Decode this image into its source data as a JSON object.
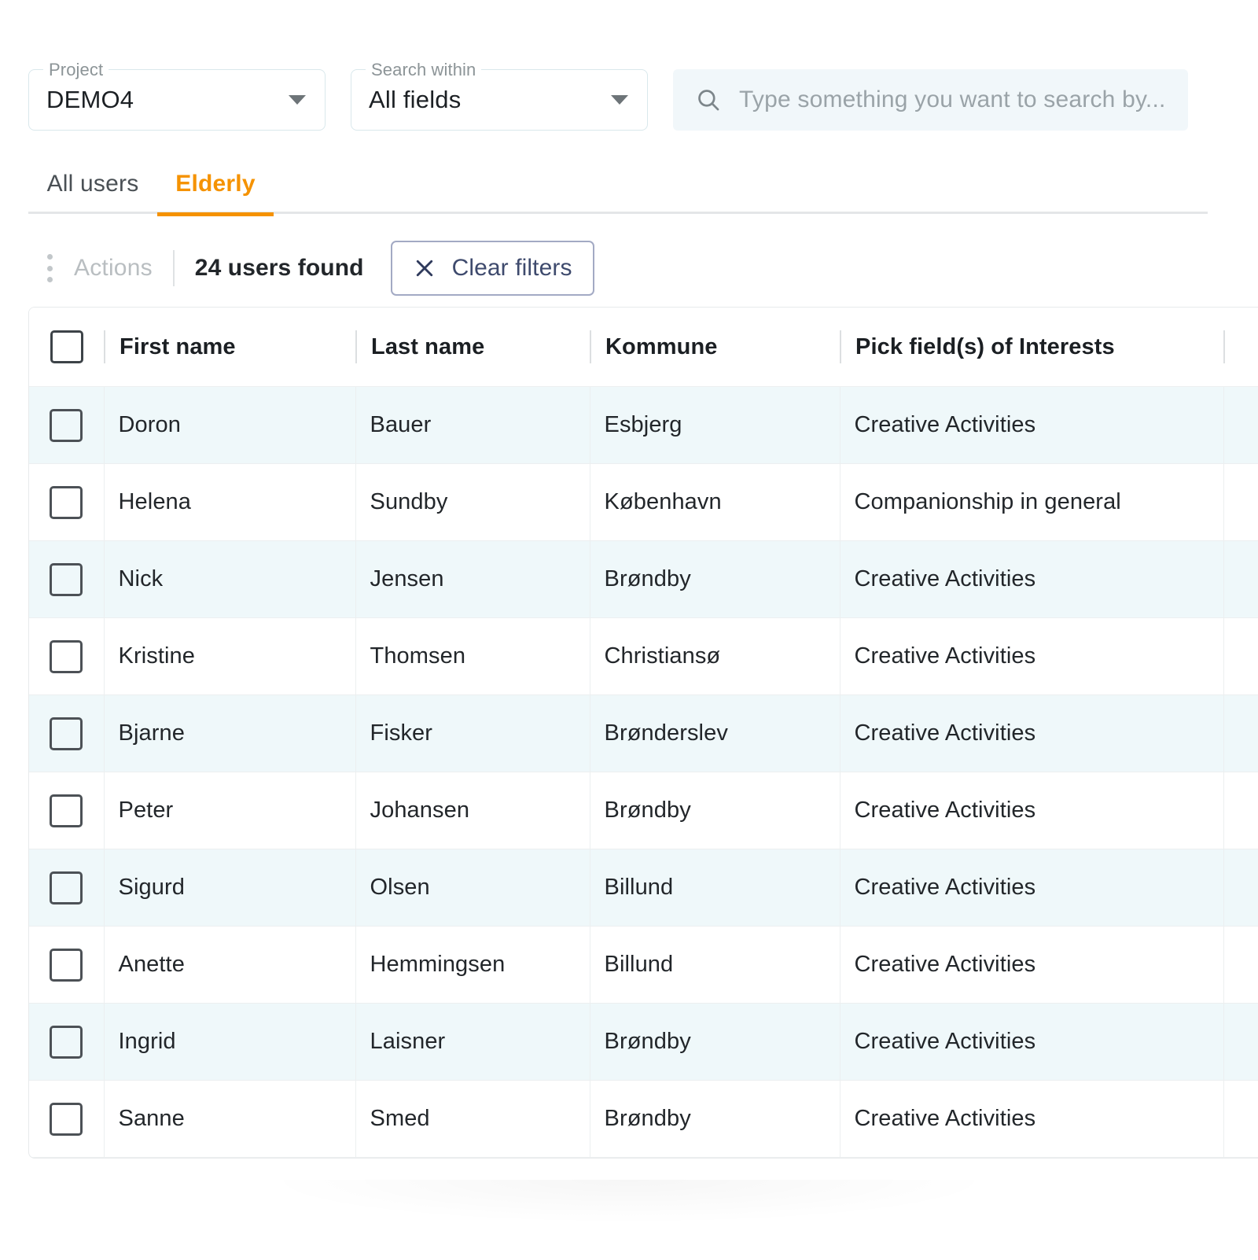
{
  "filters": {
    "project": {
      "label": "Project",
      "value": "DEMO4"
    },
    "search_within": {
      "label": "Search within",
      "value": "All fields"
    },
    "search": {
      "placeholder": "Type something you want to search by...",
      "value": ""
    }
  },
  "tabs": [
    {
      "label": "All users",
      "active": false
    },
    {
      "label": "Elderly",
      "active": true
    }
  ],
  "toolbar": {
    "actions_label": "Actions",
    "results_count": "24 users found",
    "clear_filters_label": "Clear filters"
  },
  "table": {
    "columns": [
      "First name",
      "Last name",
      "Kommune",
      "Pick field(s) of Interests"
    ],
    "rows": [
      {
        "first_name": "Doron",
        "last_name": "Bauer",
        "kommune": "Esbjerg",
        "interests": "Creative Activities"
      },
      {
        "first_name": "Helena",
        "last_name": "Sundby",
        "kommune": "København",
        "interests": "Companionship in general"
      },
      {
        "first_name": "Nick",
        "last_name": "Jensen",
        "kommune": "Brøndby",
        "interests": "Creative Activities"
      },
      {
        "first_name": "Kristine",
        "last_name": "Thomsen",
        "kommune": "Christiansø",
        "interests": "Creative Activities"
      },
      {
        "first_name": "Bjarne",
        "last_name": "Fisker",
        "kommune": "Brønderslev",
        "interests": "Creative Activities"
      },
      {
        "first_name": "Peter",
        "last_name": "Johansen",
        "kommune": "Brøndby",
        "interests": "Creative Activities"
      },
      {
        "first_name": "Sigurd",
        "last_name": "Olsen",
        "kommune": "Billund",
        "interests": "Creative Activities"
      },
      {
        "first_name": "Anette",
        "last_name": "Hemmingsen",
        "kommune": "Billund",
        "interests": "Creative Activities"
      },
      {
        "first_name": "Ingrid",
        "last_name": "Laisner",
        "kommune": "Brøndby",
        "interests": "Creative Activities"
      },
      {
        "first_name": "Sanne",
        "last_name": "Smed",
        "kommune": "Brøndby",
        "interests": "Creative Activities"
      }
    ]
  },
  "colors": {
    "accent_orange": "#f59200",
    "row_stripe": "#eff8fa",
    "search_bg": "#f1f7fa",
    "button_border": "#a3aac4",
    "button_text": "#3e4a6d"
  }
}
